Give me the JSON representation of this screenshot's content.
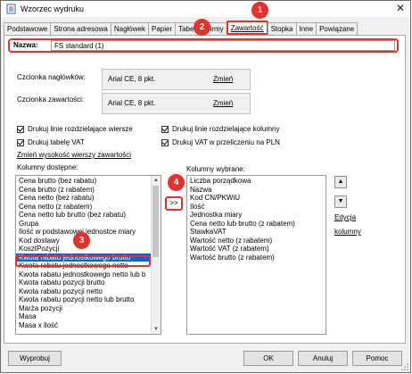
{
  "window": {
    "title": "Wzorzec wydruku",
    "close_glyph": "✕"
  },
  "tabs": [
    {
      "label": "Podstawowe"
    },
    {
      "label": "Strona adresowa"
    },
    {
      "label": "Nagłówek"
    },
    {
      "label": "Papier"
    },
    {
      "label": "Tabela"
    },
    {
      "label": "Firmy"
    },
    {
      "label": "Zawartość"
    },
    {
      "label": "Stopka"
    },
    {
      "label": "Inne"
    },
    {
      "label": "Powiązane"
    }
  ],
  "active_tab": "Zawartość",
  "name_field": {
    "label": "Nazwa:",
    "value": "FS standard (1)"
  },
  "fonts": {
    "header_label": "Czcionka nagłówków:",
    "header_value": "Arial CE, 8 pkt.",
    "content_label": "Czcionka zawartości:",
    "content_value": "Arial CE, 8 pkt.",
    "change_label": "Zmień"
  },
  "options": {
    "row_lines": "Drukuj linie rozdzielające wiersze",
    "col_lines": "Drukuj linie rozdzielające kolumny",
    "vat_table": "Drukuj tabelę VAT",
    "vat_pln": "Drukuj VAT w przeliczeniu na PLN",
    "row_height_link": "Zmień wysokość wierszy zawartości"
  },
  "available": {
    "label": "Kolumny dostępne:",
    "items": [
      "Cena brutto (bez rabatu)",
      "Cena brutto (z rabatem)",
      "Cena netto (bez rabatu)",
      "Cena netto (z rabatem)",
      "Cena netto lub brutto (bez rabatu)",
      "Grupa",
      "Ilość w podstawowej jednostce miary",
      "Kod dostawy",
      "KosztPozycji",
      "Kwota rabatu jednostkowego brutto",
      "Kwota rabatu jednostkowego netto",
      "Kwota rabatu jednostkowego netto lub b",
      "Kwota rabatu pozycji brutto",
      "Kwota rabatu pozycji netto",
      "Kwota rabatu pozycji netto lub brutto",
      "Marża pozycji",
      "Masa",
      "Masa x ilość"
    ],
    "selected_index": 9
  },
  "add_button": ">>",
  "chosen": {
    "label": "Kolumny wybrane:",
    "items": [
      "Liczba porządkowa",
      "Nazwa",
      "Kod CN/PKWiU",
      "Ilość",
      "Jednostka miary",
      "Cena netto lub brutto (z rabatem)",
      "StawkaVAT",
      "Wartość netto (z rabatem)",
      "Wartość VAT (z rabatem)",
      "Wartość brutto (z rabatem)"
    ]
  },
  "side": {
    "up_glyph": "▲",
    "down_glyph": "▼",
    "edit_line1": "Edycja",
    "edit_line2": "kolumny"
  },
  "footer": {
    "print": "Wyprobuj",
    "ok": "OK",
    "cancel": "Anuluj",
    "help": "Pomoc"
  },
  "badges": {
    "b1": "1",
    "b2": "2",
    "b3": "3",
    "b4": "4"
  },
  "colors": {
    "accent_red": "#e8302a",
    "selection_blue": "#0a64d6"
  }
}
